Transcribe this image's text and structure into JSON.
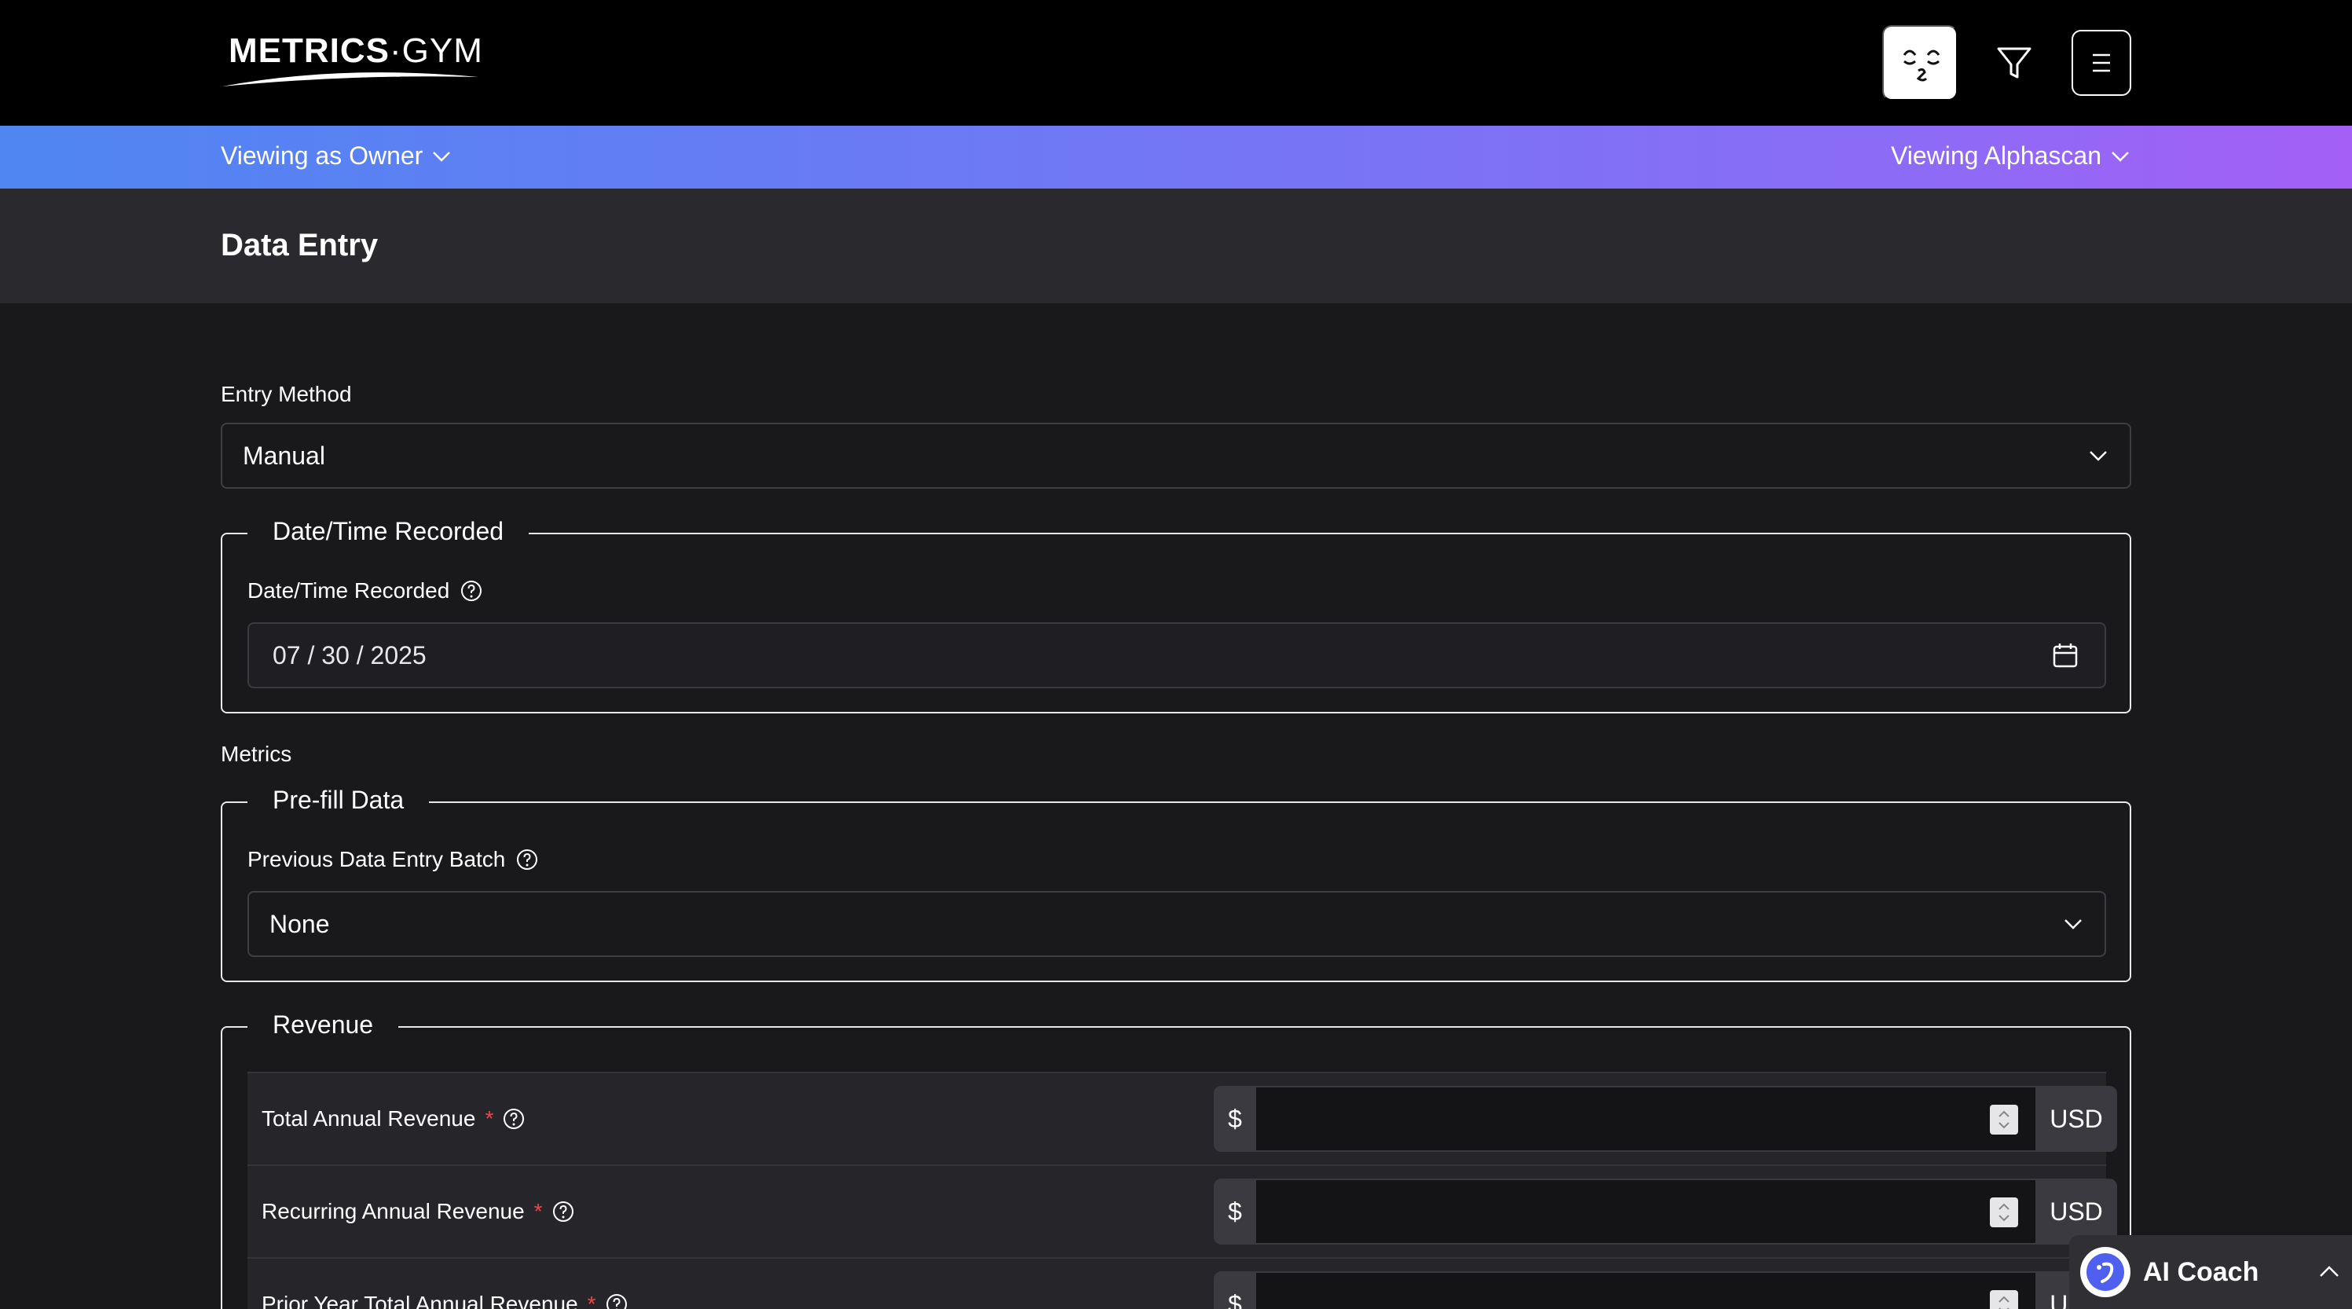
{
  "header": {
    "logo_bold": "METRICS",
    "logo_dot": "·",
    "logo_light": "GYM",
    "filter_icon": "filter-icon",
    "menu_icon": "hamburger-menu-icon",
    "avatar_icon": "face-avatar-icon"
  },
  "view_bar": {
    "role_label": "Viewing as Owner",
    "company_label": "Viewing Alphascan",
    "gradient_start": "#4f86f2",
    "gradient_end": "#a45ff6"
  },
  "page": {
    "title": "Data Entry"
  },
  "entry_method": {
    "label": "Entry Method",
    "value": "Manual"
  },
  "datetime_section": {
    "legend": "Date/Time Recorded",
    "field_label": "Date/Time Recorded",
    "value": "07 / 30 / 2025"
  },
  "metrics": {
    "label": "Metrics"
  },
  "prefill": {
    "legend": "Pre-fill Data",
    "field_label": "Previous Data Entry Batch",
    "value": "None"
  },
  "revenue": {
    "legend": "Revenue",
    "rows": [
      {
        "label": "Total Annual Revenue",
        "required": "*",
        "prefix": "$",
        "suffix": "USD",
        "value": ""
      },
      {
        "label": "Recurring Annual Revenue",
        "required": "*",
        "prefix": "$",
        "suffix": "USD",
        "value": ""
      },
      {
        "label": "Prior Year Total Annual Revenue",
        "required": "*",
        "prefix": "$",
        "suffix": "USD",
        "value": ""
      }
    ]
  },
  "ai_coach": {
    "label": "AI Coach"
  }
}
